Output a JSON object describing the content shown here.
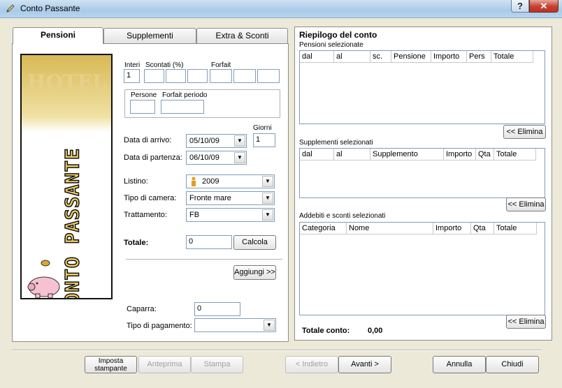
{
  "window": {
    "title": "Conto Passante",
    "help_label": "?",
    "close_label": "✕"
  },
  "tabs": [
    {
      "label": "Pensioni",
      "active": true
    },
    {
      "label": "Supplementi",
      "active": false
    },
    {
      "label": "Extra & Sconti",
      "active": false
    }
  ],
  "image": {
    "logo_text": "CONTO PASSANTE",
    "bg_text": "HOTEL"
  },
  "form": {
    "interi_label": "Interi",
    "interi_value": "1",
    "scontati_label": "Scontati (%)",
    "forfait_label": "Forfait",
    "persone_label": "Persone",
    "forfait_periodo_label": "Forfait periodo",
    "giorni_label": "Giorni",
    "giorni_value": "1",
    "arrivo_label": "Data di arrivo:",
    "arrivo_value": "05/10/09",
    "partenza_label": "Data di partenza:",
    "partenza_value": "06/10/09",
    "listino_label": "Listino:",
    "listino_value": "2009",
    "camera_label": "Tipo di camera:",
    "camera_value": "Fronte mare",
    "trattamento_label": "Trattamento:",
    "trattamento_value": "FB",
    "totale_label": "Totale:",
    "totale_value": "0",
    "calcola_label": "Calcola",
    "aggiungi_label": "Aggiungi >>",
    "caparra_label": "Caparra:",
    "caparra_value": "0",
    "pagamento_label": "Tipo di pagamento:",
    "pagamento_value": ""
  },
  "summary": {
    "title": "Riepilogo del conto",
    "pensioni_label": "Pensioni selezionate",
    "pensioni_cols": [
      "dal",
      "al",
      "sc.",
      "Pensione",
      "Importo",
      "Pers",
      "Totale"
    ],
    "supplementi_label": "Supplementi selezionati",
    "supplementi_cols": [
      "dal",
      "al",
      "Supplemento",
      "Importo",
      "Qta",
      "Totale"
    ],
    "addebiti_label": "Addebiti e sconti selezionati",
    "addebiti_cols": [
      "Categoria",
      "Nome",
      "Importo",
      "Qta",
      "Totale"
    ],
    "elimina_label": "<< Elimina",
    "totale_conto_label": "Totale conto:",
    "totale_conto_value": "0,00"
  },
  "footer": {
    "imposta_line1": "Imposta",
    "imposta_line2": "stampante",
    "anteprima": "Anteprima",
    "stampa": "Stampa",
    "indietro": "< Indietro",
    "avanti": "Avanti >",
    "annulla": "Annulla",
    "chiudi": "Chiudi"
  }
}
